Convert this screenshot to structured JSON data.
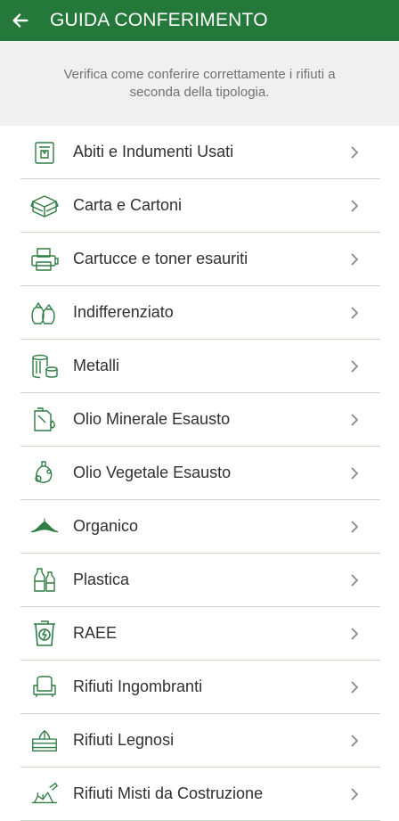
{
  "header": {
    "title": "GUIDA CONFERIMENTO",
    "back_icon": "arrow-left-icon",
    "background": "#24793a"
  },
  "intro": {
    "text": "Verifica come conferire correttamente i rifiuti a seconda della tipologia."
  },
  "categories": [
    {
      "label": "Abiti e Indumenti Usati",
      "icon": "clothes-bin-icon"
    },
    {
      "label": "Carta e Cartoni",
      "icon": "cardboard-box-icon"
    },
    {
      "label": "Cartucce e toner esauriti",
      "icon": "printer-icon"
    },
    {
      "label": "Indifferenziato",
      "icon": "garbage-bags-icon"
    },
    {
      "label": "Metalli",
      "icon": "metal-cans-icon"
    },
    {
      "label": "Olio Minerale Esausto",
      "icon": "oil-canister-icon"
    },
    {
      "label": "Olio Vegetale Esausto",
      "icon": "oil-bottle-icon"
    },
    {
      "label": "Organico",
      "icon": "organic-leaf-icon"
    },
    {
      "label": "Plastica",
      "icon": "plastic-bottles-icon"
    },
    {
      "label": "RAEE",
      "icon": "electronics-bin-icon"
    },
    {
      "label": "Rifiuti Ingombranti",
      "icon": "armchair-icon"
    },
    {
      "label": "Rifiuti Legnosi",
      "icon": "wood-crate-icon"
    },
    {
      "label": "Rifiuti Misti da Costruzione",
      "icon": "construction-icon"
    }
  ],
  "colors": {
    "accent": "#24793a",
    "icon": "#2f7d44",
    "chevron": "#8a8a8a",
    "divider": "#c8d8cc"
  }
}
